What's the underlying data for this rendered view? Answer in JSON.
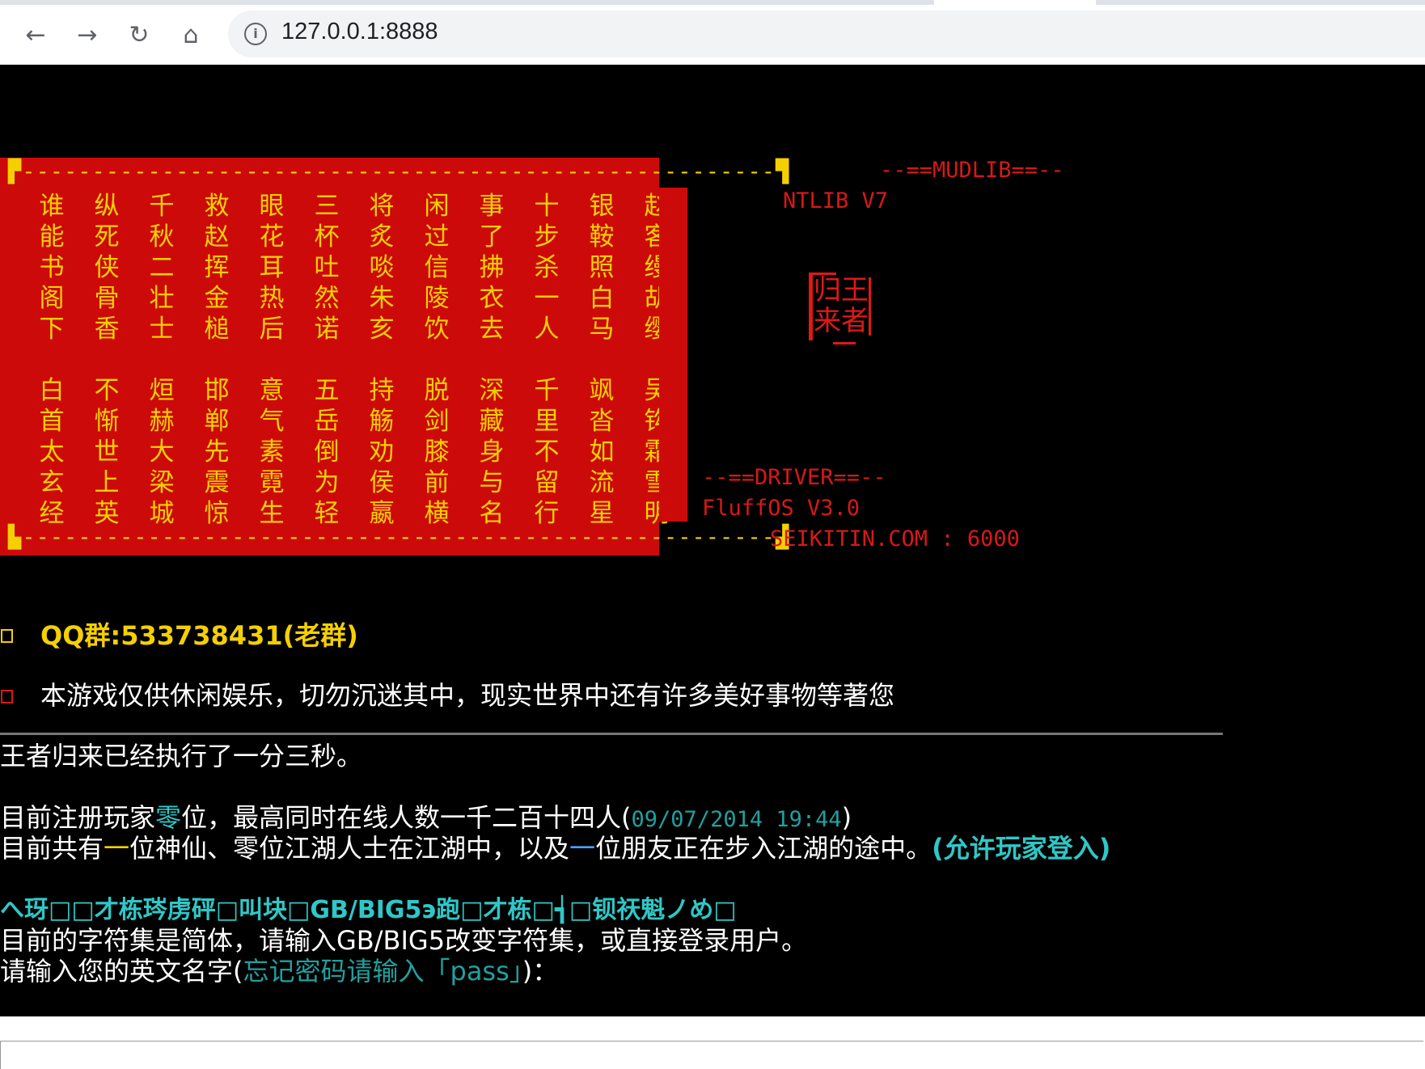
{
  "browser": {
    "url": "127.0.0.1:8888",
    "buttons": {
      "back": "←",
      "forward": "→",
      "reload": "↻",
      "home": "⌂"
    },
    "info_icon": "i"
  },
  "banner": {
    "dash_top": "▛------------------------------------------------------▜",
    "dash_bottom": "▙------------------------------------------------------▟",
    "block1": [
      [
        "谁",
        "纵",
        "千",
        "救",
        "眼",
        "三",
        "将",
        "闲",
        "事",
        "十",
        "银",
        "赵"
      ],
      [
        "能",
        "死",
        "秋",
        "赵",
        "花",
        "杯",
        "炙",
        "过",
        "了",
        "步",
        "鞍",
        "客"
      ],
      [
        "书",
        "侠",
        "二",
        "挥",
        "耳",
        "吐",
        "啖",
        "信",
        "拂",
        "杀",
        "照",
        "缦"
      ],
      [
        "阁",
        "骨",
        "壮",
        "金",
        "热",
        "然",
        "朱",
        "陵",
        "衣",
        "一",
        "白",
        "胡"
      ],
      [
        "下",
        "香",
        "士",
        "槌",
        "后",
        "诺",
        "亥",
        "饮",
        "去",
        "人",
        "马",
        "缨"
      ]
    ],
    "block2": [
      [
        "白",
        "不",
        "烜",
        "邯",
        "意",
        "五",
        "持",
        "脱",
        "深",
        "千",
        "飒",
        "吴"
      ],
      [
        "首",
        "惭",
        "赫",
        "郸",
        "气",
        "岳",
        "觞",
        "剑",
        "藏",
        "里",
        "沓",
        "钩"
      ],
      [
        "太",
        "世",
        "大",
        "先",
        "素",
        "倒",
        "劝",
        "膝",
        "身",
        "不",
        "如",
        "霜"
      ],
      [
        "玄",
        "上",
        "梁",
        "震",
        "霓",
        "为",
        "侯",
        "前",
        "与",
        "留",
        "流",
        "雪"
      ],
      [
        "经",
        "英",
        "城",
        "惊",
        "生",
        "轻",
        "嬴",
        "横",
        "名",
        "行",
        "星",
        "明"
      ]
    ]
  },
  "mudlib": {
    "header": "--==MUDLIB==--",
    "name": "NTLIB V7"
  },
  "logo": {
    "line1": "归王",
    "line2": "来者"
  },
  "driver": {
    "header": "--==DRIVER==--",
    "name": "FluffOS V3.0",
    "host": "SEIKITIN.COM : 6000"
  },
  "notices": {
    "qq": "QQ群:533738431(老群)",
    "health": "本游戏仅供休闲娱乐，切勿沉迷其中，现实世界中还有许多美好事物等著您"
  },
  "status": {
    "uptime": "王者归来已经执行了一分三秒。",
    "reg_prefix": "目前注册玩家",
    "reg_count": "零",
    "reg_mid": "位，最高同时在线人数一千二百十四人(",
    "reg_date": "09/07/2014 19:44",
    "reg_suffix": ")",
    "online_prefix": "目前共有",
    "online_gods": "一",
    "online_mid": "位神仙、零位江湖人士在江湖中，以及",
    "online_friends": "一",
    "online_suffix": "位朋友正在步入江湖的途中。",
    "online_allow": "(允许玩家登入)"
  },
  "charset": {
    "garbled": "へ玡□□才栋琌虏砰□叫块□GB/BIG5э跑□才栋□┪□钡祆魁ノめ□",
    "prompt": "目前的字符集是简体，请输入GB/BIG5改变字符集，或直接登录用户。"
  },
  "login": {
    "prefix": "请输入您的英文名字(",
    "hint": "忘记密码请输入「pass」",
    "suffix": ")："
  },
  "input": {
    "value": "",
    "placeholder": ""
  }
}
